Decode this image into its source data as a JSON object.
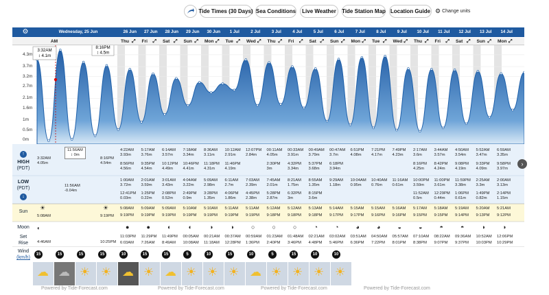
{
  "nav": {
    "buttons": [
      "Tide Times (30 Days)",
      "Sea Conditions",
      "Live Weather",
      "Tide Station Map",
      "Location Guide"
    ],
    "change_units": "Change units"
  },
  "header": {
    "first_day": "Wednesday, 25 Jun",
    "days": [
      "26 Jun",
      "27 Jun",
      "28 Jun",
      "29 Jun",
      "30 Jun",
      "1 Jul",
      "2 Jul",
      "3 Jul",
      "4 Jul",
      "5 Jul",
      "6 Jul",
      "7 Jul",
      "8 Jul",
      "9 Jul",
      "10 Jul",
      "11 Jul",
      "12 Jul",
      "13 Jul",
      "14 Jul"
    ],
    "first_label": "AM",
    "dows": [
      "Thu",
      "Fri",
      "Sat",
      "Sun",
      "Mon",
      "Tue",
      "Wed",
      "Thu",
      "Fri",
      "Sat",
      "Sun",
      "Mon",
      "Tue",
      "Wed",
      "Thu",
      "Fri",
      "Sat",
      "Sun",
      "Mon"
    ]
  },
  "chart_data": {
    "type": "area",
    "ylabel": "",
    "yticks": [
      "4.3m",
      "3.7m",
      "3.2m",
      "2.7m",
      "2.1m",
      "1.6m",
      "1m",
      "0.5m",
      "0m"
    ],
    "ylim": [
      0,
      4.5
    ],
    "annotations": [
      {
        "time": "3:32AM",
        "height": "↕ 4.1m"
      },
      {
        "time": "8:16PM",
        "height": "↕ 4.5m"
      },
      {
        "time": "11:56AM",
        "height": "↕ 0m"
      }
    ],
    "series": [
      {
        "values": [
          4.05,
          -0.04,
          4.54,
          0.03,
          3.93,
          0.21,
          3.76,
          0.52,
          3.57,
          0.9,
          3.34,
          1.29,
          3.11,
          1.74,
          2.91,
          2.39,
          2.84,
          2.52,
          4.05,
          1.75,
          3.91,
          1.8,
          3.7,
          1.62,
          3.6,
          0.95,
          4.08,
          0.76,
          4.17,
          0.61,
          4.23,
          0.5,
          3.6,
          0.44,
          3.57,
          0.61,
          3.54,
          0.82,
          3.47,
          1.15,
          3.35,
          1.51,
          3.41
        ]
      }
    ]
  },
  "tides": {
    "high_label": "HIGH",
    "low_label": "LOW",
    "tz": "(PDT)",
    "first": {
      "high1": "3:32AM",
      "high1_h": "4.05m",
      "low1": "11:56AM",
      "low1_h": "-0.04m",
      "high2": "8:16PM",
      "high2_h": "4.54m",
      "annot_time": "11:56AM",
      "annot_h": "↕ 0m"
    },
    "highs": [
      [
        "4:22AM",
        "3.93m",
        "8:56PM",
        "4.56m"
      ],
      [
        "5:17AM",
        "3.76m",
        "9:35PM",
        "4.54m"
      ],
      [
        "6:14AM",
        "3.57m",
        "10:12PM",
        "4.49m"
      ],
      [
        "7:18AM",
        "3.34m",
        "10:46PM",
        "4.41m"
      ],
      [
        "8:36AM",
        "3.11m",
        "11:18PM",
        "4.31m"
      ],
      [
        "10:12AM",
        "2.91m",
        "11:46PM",
        "4.19m"
      ],
      [
        "12:07PM",
        "2.84m",
        "",
        ""
      ],
      [
        "00:11AM",
        "4.05m",
        "2:30PM",
        "3m"
      ],
      [
        "00:33AM",
        "3.91m",
        "4:32PM",
        "3.34m"
      ],
      [
        "00:49AM",
        "3.79m",
        "5:37PM",
        "3.68m"
      ],
      [
        "00:47AM",
        "3.7m",
        "6:18PM",
        "3.94m"
      ],
      [
        "6:51PM",
        "4.08m",
        "",
        ""
      ],
      [
        "7:21PM",
        "4.17m",
        "",
        ""
      ],
      [
        "7:49PM",
        "4.23m",
        "",
        ""
      ],
      [
        "2:17AM",
        "3.6m",
        "8:16PM",
        "4.25m"
      ],
      [
        "3:44AM",
        "3.57m",
        "8:42PM",
        "4.24m"
      ],
      [
        "4:50AM",
        "3.54m",
        "9:08PM",
        "4.19m"
      ],
      [
        "5:52AM",
        "3.47m",
        "9:33PM",
        "4.09m"
      ],
      [
        "6:59AM",
        "3.35m",
        "9:58PM",
        "3.97m"
      ]
    ],
    "lows": [
      [
        "1:00AM",
        "3.72m",
        "12:41PM",
        "0.03m"
      ],
      [
        "2:01AM",
        "3.59m",
        "1:25PM",
        "0.22m"
      ],
      [
        "3:01AM",
        "3.43m",
        "2:08PM",
        "0.52m"
      ],
      [
        "4:04AM",
        "3.22m",
        "2:49PM",
        "0.9m"
      ],
      [
        "5:09AM",
        "2.98m",
        "3:28PM",
        "1.35m"
      ],
      [
        "6:11AM",
        "2.7m",
        "4:06PM",
        "1.86m"
      ],
      [
        "7:03AM",
        "2.39m",
        "4:45PM",
        "2.38m"
      ],
      [
        "7:45AM",
        "2.01m",
        "5:28PM",
        "2.87m"
      ],
      [
        "8:21AM",
        "1.75m",
        "6:32PM",
        "3m"
      ],
      [
        "8:55AM",
        "1.35m",
        "8:15PM",
        "3.6m"
      ],
      [
        "9:29AM",
        "1.18m",
        "",
        ""
      ],
      [
        "10:04AM",
        "0.95m",
        "",
        ""
      ],
      [
        "10:40AM",
        "0.76m",
        "",
        ""
      ],
      [
        "11:16AM",
        "0.61m",
        "",
        ""
      ],
      [
        "10:00PM",
        "3.59m",
        "11:52AM",
        "0.5m"
      ],
      [
        "11:00PM",
        "3.61m",
        "12:29PM",
        "0.44m"
      ],
      [
        "11:59PM",
        "3.38m",
        "1:06PM",
        "0.61m"
      ],
      [
        "2:25AM",
        "3.3m",
        "1:49PM",
        "0.82m"
      ],
      [
        "2:00AM",
        "3.13m",
        "2:14PM",
        "1.15m"
      ]
    ]
  },
  "sun": {
    "label": "Sun",
    "first_rise": "5:08AM",
    "first_set": "9:19PM",
    "rows": [
      [
        "5:08AM",
        "9:19PM"
      ],
      [
        "5:09AM",
        "9:19PM"
      ],
      [
        "5:09AM",
        "9:19PM"
      ],
      [
        "5:10AM",
        "9:19PM"
      ],
      [
        "5:10AM",
        "9:19PM"
      ],
      [
        "5:11AM",
        "9:19PM"
      ],
      [
        "5:11AM",
        "9:19PM"
      ],
      [
        "5:12AM",
        "9:18PM"
      ],
      [
        "5:12AM",
        "9:18PM"
      ],
      [
        "5:13AM",
        "9:18PM"
      ],
      [
        "5:14AM",
        "9:17PM"
      ],
      [
        "5:15AM",
        "9:17PM"
      ],
      [
        "5:15AM",
        "9:16PM"
      ],
      [
        "5:16AM",
        "9:16PM"
      ],
      [
        "5:17AM",
        "9:15PM"
      ],
      [
        "5:18AM",
        "9:15PM"
      ],
      [
        "5:19AM",
        "9:14PM"
      ],
      [
        "5:20AM",
        "9:13PM"
      ],
      [
        "5:21AM",
        "9:12PM"
      ]
    ]
  },
  "moon": {
    "label": "Moon",
    "set_label": "Set",
    "rise_label": "Rise",
    "first_rise": "4:46AM",
    "first_set": "10:25PM",
    "rows": [
      [
        "11:03PM",
        "6:03AM"
      ],
      [
        "11:29PM",
        "7:26AM"
      ],
      [
        "11:49PM",
        "8:49AM"
      ],
      [
        "00:05AM",
        "10:08AM"
      ],
      [
        "00:21AM",
        "11:18AM"
      ],
      [
        "00:37AM",
        "12:28PM"
      ],
      [
        "00:59AM",
        "1:36PM"
      ],
      [
        "01:23AM",
        "2:40PM"
      ],
      [
        "01:48AM",
        "3:46PM"
      ],
      [
        "02:21AM",
        "4:48PM"
      ],
      [
        "03:02AM",
        "5:46PM"
      ],
      [
        "03:51AM",
        "6:36PM"
      ],
      [
        "04:50AM",
        "7:22PM"
      ],
      [
        "05:57AM",
        "8:01PM"
      ],
      [
        "07:10AM",
        "8:38PM"
      ],
      [
        "08:22AM",
        "9:07PM"
      ],
      [
        "09:36AM",
        "9:37PM"
      ],
      [
        "10:52AM",
        "10:03PM"
      ],
      [
        "12:06PM",
        "10:29PM"
      ]
    ]
  },
  "wind": {
    "label": "Wind",
    "unit": "(km/h)",
    "values": [
      "15",
      "15",
      "15",
      "15",
      "10",
      "15",
      "15",
      "5",
      "10",
      "15",
      "10",
      "5",
      "15",
      "10",
      "10"
    ]
  },
  "weather": [
    "cloudy-sun",
    "rain",
    "sunny",
    "sunny",
    "cloudy-night",
    "sunny",
    "cloudy-sun",
    "sunny",
    "sunny",
    "sunny",
    "cloudy-sun",
    "sunny",
    "sunny",
    "sunny",
    "sunny"
  ],
  "footer": "Powered by Tide-Forecast.com",
  "colors": {
    "header": "#1f5aa0",
    "tide_fill": "#3f7fc2",
    "tide_line": "#1d5fa9",
    "night": "#e4e4e4",
    "sun_row": "#fff9cf"
  }
}
